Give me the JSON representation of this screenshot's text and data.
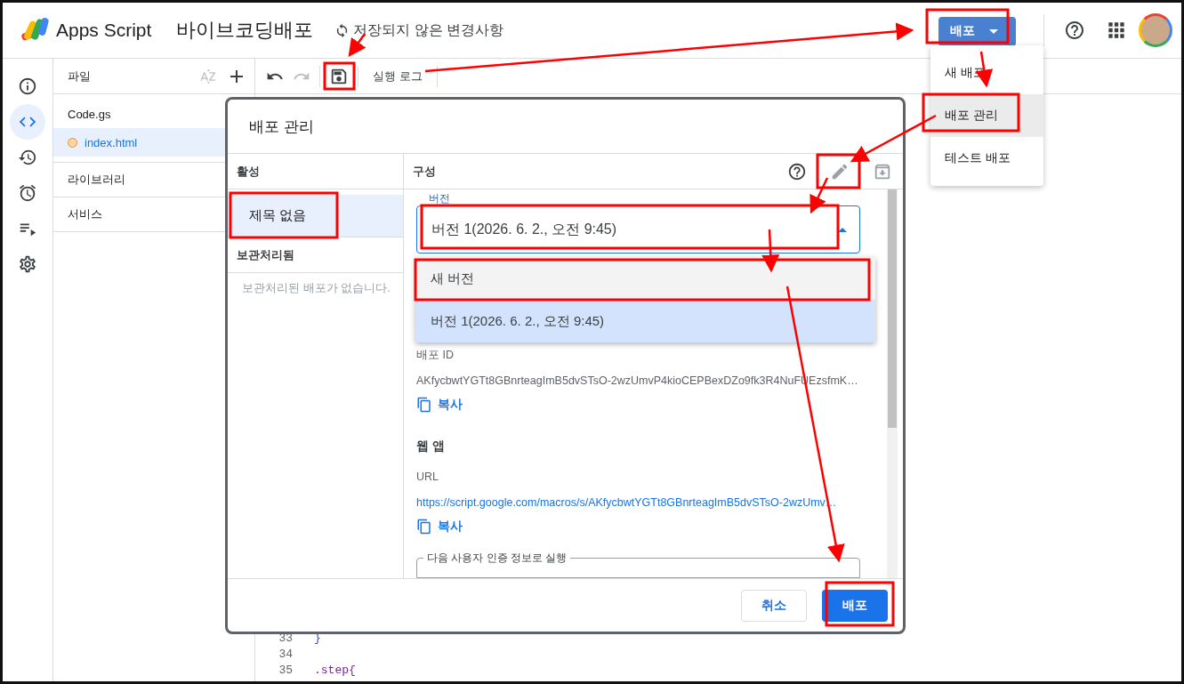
{
  "header": {
    "product": "Apps Script",
    "project": "바이브코딩배포",
    "save_status": "저장되지 않은 변경사항",
    "deploy_button": "배포"
  },
  "deploy_menu": {
    "items": [
      {
        "label": "새 배포",
        "hovered": false
      },
      {
        "label": "배포 관리",
        "hovered": true
      },
      {
        "label": "테스트 배포",
        "hovered": false
      }
    ]
  },
  "rail": [
    {
      "kind": "info",
      "selected": false
    },
    {
      "kind": "code",
      "selected": true
    },
    {
      "kind": "history",
      "selected": false
    },
    {
      "kind": "triggers",
      "selected": false
    },
    {
      "kind": "executions",
      "selected": false
    },
    {
      "kind": "settings",
      "selected": false
    }
  ],
  "files": {
    "title": "파일",
    "items": [
      {
        "name": "Code.gs",
        "selected": false,
        "unsaved": false
      },
      {
        "name": "index.html",
        "selected": true,
        "unsaved": true
      }
    ]
  },
  "sections": [
    "라이브러리",
    "서비스"
  ],
  "toolbar": {
    "run_log": "실행 로그"
  },
  "editor": {
    "lines": [
      {
        "number": "33",
        "code": "}",
        "kind": "brace"
      },
      {
        "number": "34"
      },
      {
        "number": "35",
        "code": ".step{",
        "kind": "selector"
      }
    ]
  },
  "dialog": {
    "title": "배포 관리",
    "active_header": "활성",
    "deployments": [
      {
        "label": "제목 없음",
        "selected": true
      }
    ],
    "archived_header": "보관처리됨",
    "archived_empty": "보관처리된 배포가 없습니다.",
    "config_header": "구성",
    "version_field": {
      "label": "버전",
      "value": "버전 1(2026. 6. 2., 오전 9:45)",
      "expanded": true
    },
    "version_options": [
      {
        "label": "새 버전",
        "hovered": true,
        "selected": false
      },
      {
        "label": "버전 1(2026. 6. 2., 오전 9:45)",
        "hovered": false,
        "selected": true
      }
    ],
    "deployment_id": {
      "label": "배포 ID",
      "value": "AKfycbwtYGTt8GBnrteagImB5dvSTsO-2wzUmvP4kioCEPBexDZo9fk3R4NuFUEzsfmK…",
      "copy": "복사"
    },
    "web_app": {
      "heading": "웹 앱",
      "url_label": "URL",
      "url": "https://script.google.com/macros/s/AKfycbwtYGTt8GBnrteagImB5dvSTsO-2wzUmv…",
      "copy": "복사"
    },
    "run_as_label": "다음 사용자 인증 정보로 실행",
    "buttons": {
      "cancel": "취소",
      "deploy": "배포"
    }
  }
}
